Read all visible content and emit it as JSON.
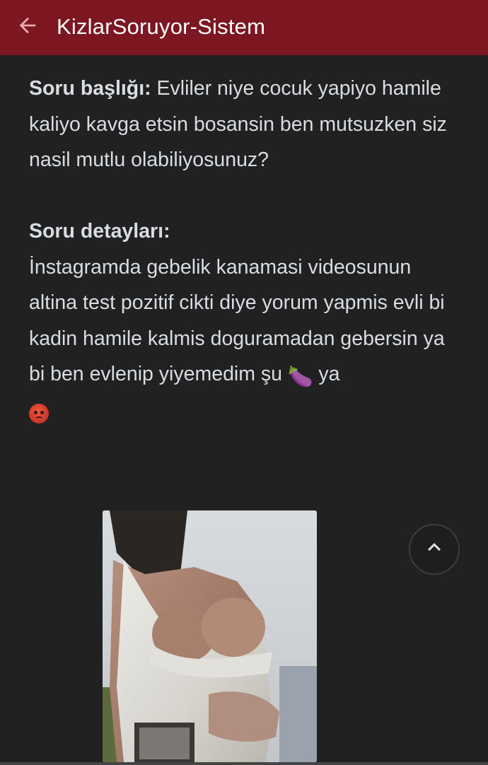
{
  "appbar": {
    "title": "KizlarSoruyor-Sistem",
    "back_icon": "arrow-left-icon"
  },
  "question": {
    "title_label": "Soru başlığı:",
    "title_text": " Evliler niye cocuk yapiyo hamile kaliyo kavga etsin bosansin ben mutsuzken siz nasil mutlu olabiliyosunuz?",
    "details_label": "Soru detayları:",
    "details_text": "İnstagramda gebelik kanamasi videosunun altina test pozitif cikti diye yorum yapmis evli bi kadin hamile kalmis doguramadan gebersin ya bi ben evlenip yiyemedim şu",
    "eggplant_emoji": "🍆",
    "details_suffix": " ya",
    "angry_icon": "angry-face-icon"
  },
  "photo": {
    "icon": "photo-image"
  },
  "scroll_top": {
    "icon": "chevron-up-icon"
  },
  "colors": {
    "appbar": "#7c1721",
    "background": "#212121",
    "text": "#d8dde3"
  }
}
